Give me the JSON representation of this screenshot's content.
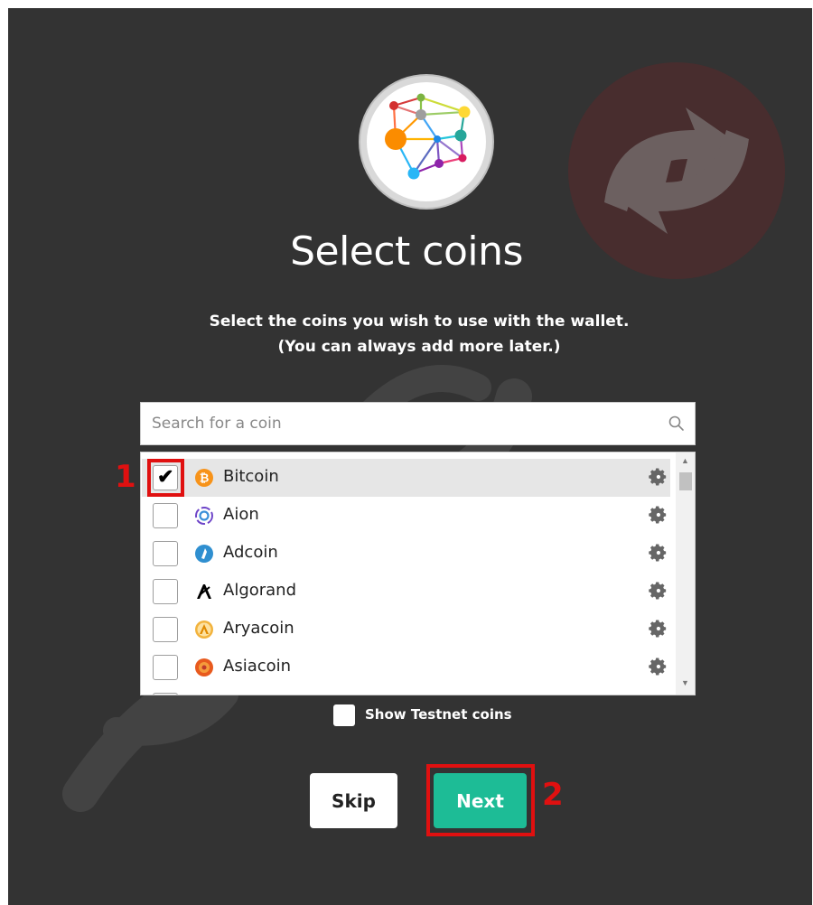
{
  "page": {
    "title": "Select coins",
    "subtitle_line1": "Select the coins you wish to use with the wallet.",
    "subtitle_line2": "(You can always add more later.)"
  },
  "search": {
    "placeholder": "Search for a coin",
    "icon": "search-icon"
  },
  "coins": [
    {
      "label": "Bitcoin",
      "checked": true,
      "icon_color": "#f7931a"
    },
    {
      "label": "Aion",
      "checked": false,
      "icon_color": "#6d44c8"
    },
    {
      "label": "Adcoin",
      "checked": false,
      "icon_color": "#2f8fd0"
    },
    {
      "label": "Algorand",
      "checked": false,
      "icon_color": "#000000"
    },
    {
      "label": "Aryacoin",
      "checked": false,
      "icon_color": "#f2b33d"
    },
    {
      "label": "Asiacoin",
      "checked": false,
      "icon_color": "#e85a1e"
    }
  ],
  "testnet": {
    "label": "Show Testnet coins",
    "checked": false
  },
  "buttons": {
    "skip_label": "Skip",
    "next_label": "Next"
  },
  "annotations": {
    "marker1": "1",
    "marker2": "2"
  },
  "colors": {
    "background": "#333333",
    "accent": "#1dbc96",
    "annotation": "#e01010"
  }
}
